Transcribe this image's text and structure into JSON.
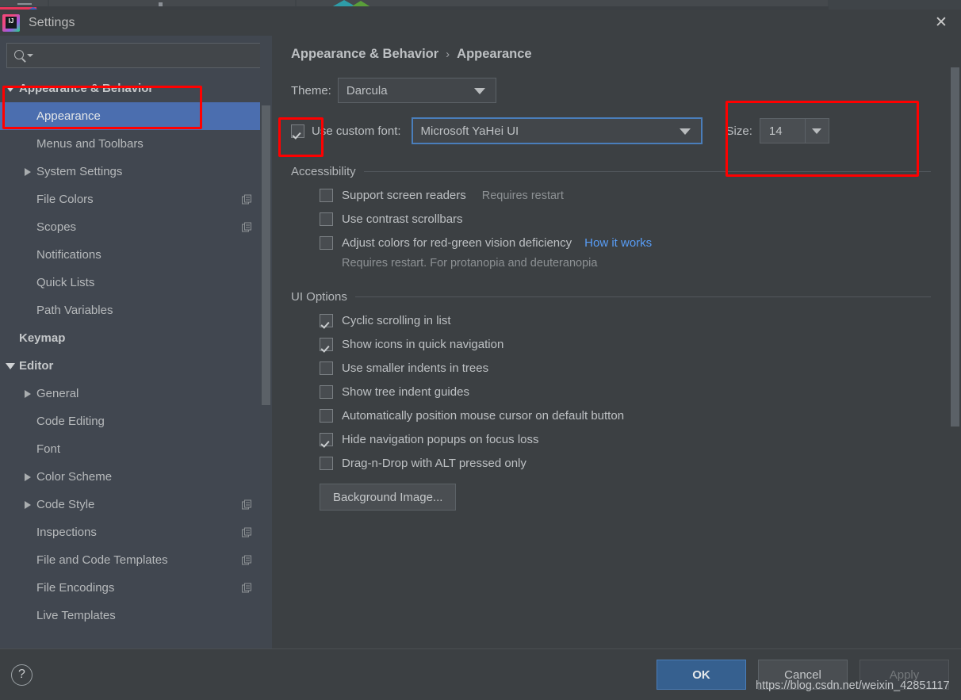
{
  "window": {
    "title": "Settings",
    "logo_text": "IJ",
    "close_icon": "✕"
  },
  "search": {
    "value": "",
    "placeholder": ""
  },
  "sidebar": {
    "items": [
      {
        "label": "Appearance & Behavior",
        "indent": 0,
        "twisty": "down",
        "bold": true,
        "selected": false,
        "copy": false
      },
      {
        "label": "Appearance",
        "indent": 1,
        "twisty": "none",
        "bold": false,
        "selected": true,
        "copy": false
      },
      {
        "label": "Menus and Toolbars",
        "indent": 1,
        "twisty": "none",
        "bold": false,
        "selected": false,
        "copy": false
      },
      {
        "label": "System Settings",
        "indent": 1,
        "twisty": "right",
        "bold": false,
        "selected": false,
        "copy": false
      },
      {
        "label": "File Colors",
        "indent": 1,
        "twisty": "none",
        "bold": false,
        "selected": false,
        "copy": true
      },
      {
        "label": "Scopes",
        "indent": 1,
        "twisty": "none",
        "bold": false,
        "selected": false,
        "copy": true
      },
      {
        "label": "Notifications",
        "indent": 1,
        "twisty": "none",
        "bold": false,
        "selected": false,
        "copy": false
      },
      {
        "label": "Quick Lists",
        "indent": 1,
        "twisty": "none",
        "bold": false,
        "selected": false,
        "copy": false
      },
      {
        "label": "Path Variables",
        "indent": 1,
        "twisty": "none",
        "bold": false,
        "selected": false,
        "copy": false
      },
      {
        "label": "Keymap",
        "indent": 0,
        "twisty": "none",
        "bold": true,
        "selected": false,
        "copy": false
      },
      {
        "label": "Editor",
        "indent": 0,
        "twisty": "down",
        "bold": true,
        "selected": false,
        "copy": false
      },
      {
        "label": "General",
        "indent": 1,
        "twisty": "right",
        "bold": false,
        "selected": false,
        "copy": false
      },
      {
        "label": "Code Editing",
        "indent": 1,
        "twisty": "none",
        "bold": false,
        "selected": false,
        "copy": false
      },
      {
        "label": "Font",
        "indent": 1,
        "twisty": "none",
        "bold": false,
        "selected": false,
        "copy": false
      },
      {
        "label": "Color Scheme",
        "indent": 1,
        "twisty": "right",
        "bold": false,
        "selected": false,
        "copy": false
      },
      {
        "label": "Code Style",
        "indent": 1,
        "twisty": "right",
        "bold": false,
        "selected": false,
        "copy": true
      },
      {
        "label": "Inspections",
        "indent": 1,
        "twisty": "none",
        "bold": false,
        "selected": false,
        "copy": true
      },
      {
        "label": "File and Code Templates",
        "indent": 1,
        "twisty": "none",
        "bold": false,
        "selected": false,
        "copy": true
      },
      {
        "label": "File Encodings",
        "indent": 1,
        "twisty": "none",
        "bold": false,
        "selected": false,
        "copy": true
      },
      {
        "label": "Live Templates",
        "indent": 1,
        "twisty": "none",
        "bold": false,
        "selected": false,
        "copy": false
      }
    ]
  },
  "breadcrumb": {
    "parent": "Appearance & Behavior",
    "separator": "›",
    "current": "Appearance"
  },
  "theme": {
    "label": "Theme:",
    "value": "Darcula"
  },
  "custom_font": {
    "checked": true,
    "label": "Use custom font:",
    "font_value": "Microsoft YaHei UI",
    "size_label": "Size:",
    "size_value": "14"
  },
  "accessibility": {
    "title": "Accessibility",
    "options": [
      {
        "label": "Support screen readers",
        "checked": false,
        "hint": "Requires restart",
        "link": ""
      },
      {
        "label": "Use contrast scrollbars",
        "checked": false,
        "hint": "",
        "link": ""
      },
      {
        "label": "Adjust colors for red-green vision deficiency",
        "checked": false,
        "hint": "",
        "link": "How it works"
      }
    ],
    "subhint": "Requires restart. For protanopia and deuteranopia"
  },
  "ui_options": {
    "title": "UI Options",
    "options": [
      {
        "label": "Cyclic scrolling in list",
        "checked": true
      },
      {
        "label": "Show icons in quick navigation",
        "checked": true
      },
      {
        "label": "Use smaller indents in trees",
        "checked": false
      },
      {
        "label": "Show tree indent guides",
        "checked": false
      },
      {
        "label": "Automatically position mouse cursor on default button",
        "checked": false
      },
      {
        "label": "Hide navigation popups on focus loss",
        "checked": true
      },
      {
        "label": "Drag-n-Drop with ALT pressed only",
        "checked": false
      }
    ],
    "background_image_button": "Background Image..."
  },
  "footer": {
    "help_label": "?",
    "ok": "OK",
    "cancel": "Cancel",
    "apply": "Apply"
  },
  "watermark": "https://blog.csdn.net/weixin_42851117",
  "colors": {
    "dialog_bg": "#3c4043",
    "sidebar_bg": "#414750",
    "selection": "#4b6eaf",
    "accent_focus": "#4a7ebb",
    "ok_button": "#36608f",
    "link": "#589df6",
    "annotation": "#ff0000",
    "text": "#bdc0c3",
    "muted_text": "#8d9194"
  }
}
